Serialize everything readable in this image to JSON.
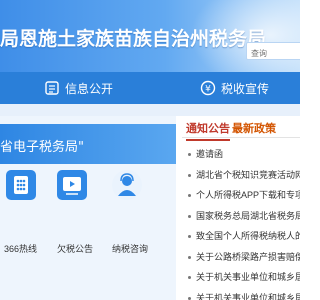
{
  "header": {
    "title": "局恩施土家族苗族自治州税务局",
    "search_placeholder": "查询"
  },
  "nav": {
    "items": [
      {
        "label": "信息公开",
        "icon": "info-icon"
      },
      {
        "label": "税收宣传",
        "icon": "megaphone-icon"
      }
    ]
  },
  "etax": {
    "title": "省电子税务局\""
  },
  "services": [
    {
      "label": "366热线",
      "icon": "phone-keypad-icon"
    },
    {
      "label": "欠税公告",
      "icon": "video-notice-icon"
    },
    {
      "label": "纳税咨询",
      "icon": "consultant-icon"
    }
  ],
  "announcements": {
    "tabs": [
      "通知公告",
      "最新政策"
    ],
    "items": [
      "邀请函",
      "湖北省个税知识竞赛活动网络",
      "个人所得税APP下载和专项附",
      "国家税务总局湖北省税务局关",
      "致全国个人所得税纳税人的一",
      "关于公路桥梁路产损害赔偿收",
      "关于机关事业单位和城乡居民",
      "关于机关事业单位和城乡居民"
    ]
  },
  "colors": {
    "header_start": "#3f8ee8",
    "nav_bg": "#2a7fd9",
    "tab_active": "#c0392b",
    "tab_other": "#d35400"
  }
}
